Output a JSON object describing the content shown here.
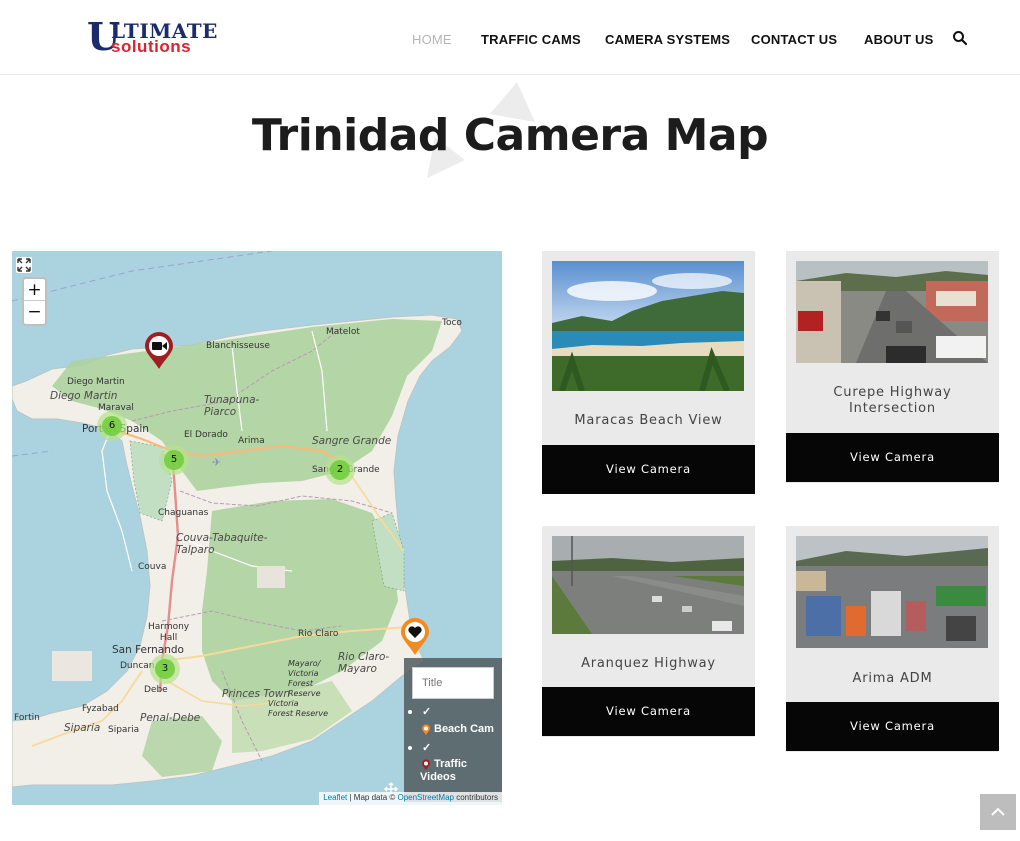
{
  "header": {
    "logo": {
      "first": "U",
      "rest": "LTIMATE",
      "sub": "solutions"
    },
    "nav": [
      {
        "label": "HOME",
        "active": true
      },
      {
        "label": "TRAFFIC CAMS",
        "active": false
      },
      {
        "label": "CAMERA SYSTEMS",
        "active": false
      },
      {
        "label": "CONTACT US",
        "active": false
      },
      {
        "label": "ABOUT US",
        "active": false
      }
    ],
    "search_icon": "search-icon"
  },
  "page": {
    "title": "Trinidad Camera Map"
  },
  "map": {
    "zoom_in": "+",
    "zoom_out": "−",
    "clusters": [
      "6",
      "5",
      "2",
      "3"
    ],
    "places": {
      "toco": "Toco",
      "matelot": "Matelot",
      "blanchisseuse": "Blanchisseuse",
      "diego_martin_town": "Diego Martin",
      "diego_martin_region": "Diego Martin",
      "maraval": "Maraval",
      "tunapuna": "Tunapuna-\nPiarco",
      "port_of_spain": "Port of Spain",
      "el_dorado": "El Dorado",
      "arima": "Arima",
      "sangre_grande_region": "Sangre Grande",
      "sangre_grande_town": "Sangre Grande",
      "chaguanas": "Chaguanas",
      "couva_region": "Couva-Tabaquite-\nTalparo",
      "couva": "Couva",
      "harmony_hall": "Harmony\nHall",
      "san_fernando": "San Fernando",
      "duncan": "Duncan",
      "debe": "Debe",
      "rio_claro": "Rio Claro",
      "rio_claro_mayaro": "Rio Claro-\nMayaro",
      "mayaro_victoria": "Mayaro/\nVictoria\nForest\nReserve",
      "victoria_forest": "Victoria\nForest Reserve",
      "princes_town": "Princes Town",
      "fyzabad": "Fyzabad",
      "penal_debe": "Penal-Debe",
      "siparia_region": "Siparia",
      "siparia": "Siparia",
      "point_fortin": "Fortin"
    },
    "legend": {
      "filter_placeholder": "Title",
      "check1": "✓",
      "item1": "Beach Cam",
      "check2": "✓",
      "item2": "Traffic\nVideos"
    },
    "attribution": {
      "leaflet": "Leaflet",
      "text": " | Map data © ",
      "osm": "OpenStreetMap",
      "suffix": " contributors"
    }
  },
  "cameras": [
    {
      "name": "Maracas Beach View",
      "button": "View Camera"
    },
    {
      "name": "Curepe Highway\nIntersection",
      "button": "View Camera"
    },
    {
      "name": "Aranquez Highway",
      "button": "View Camera"
    },
    {
      "name": "Arima ADM",
      "button": "View Camera"
    }
  ],
  "colors": {
    "accent_brand": "#1c2b6b",
    "accent_red": "#d9232d",
    "water": "#aad3df",
    "land": "#f2efe9",
    "forest": "#add19e",
    "button_bg": "#060606",
    "card_bg": "#eaeaea"
  }
}
